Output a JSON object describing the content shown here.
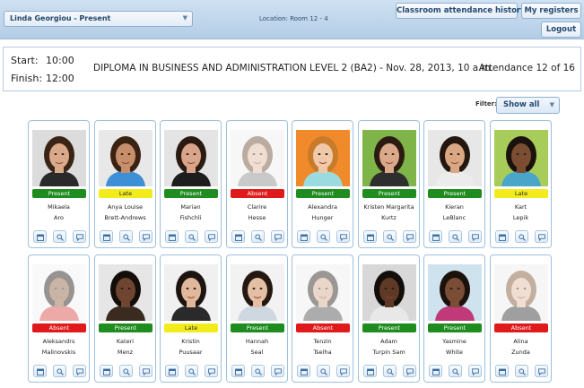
{
  "header": {
    "user_select": "Linda Georgiou - Present",
    "location": "Location: Room 12 - 4",
    "history_button": "Classroom attendance history",
    "registers_button": "My registers",
    "logout_button": "Logout"
  },
  "session": {
    "start_label": "Start:",
    "start_time": "10:00",
    "finish_label": "Finish:",
    "finish_time": "12:00",
    "course": "DIPLOMA IN BUSINESS AND ADMINISTRATION LEVEL 2 (BA2) - Nov. 28, 2013, 10 a.m.",
    "attendance": "Attendance 12 of 16"
  },
  "filter": {
    "label": "Filter:",
    "value": "Show all"
  },
  "colors": {
    "present": "#1f8c1f",
    "late": "#f2ec1d",
    "absent": "#e01a1a",
    "accent": "#244a73"
  },
  "students": [
    {
      "first": "Mikaela",
      "last": "Aro",
      "status": "Present",
      "skin": "#d9a98a",
      "hair": "#3a2416",
      "bg": "#dcdcdc",
      "shirt": "#2a2a2a"
    },
    {
      "first": "Anya Louise",
      "last": "Brett-Andrews",
      "status": "Late",
      "skin": "#c78e6b",
      "hair": "#3b2314",
      "bg": "#e8e8e8",
      "shirt": "#3d8fd6"
    },
    {
      "first": "Marian",
      "last": "Fishchli",
      "status": "Present",
      "skin": "#d8a58a",
      "hair": "#2b1a12",
      "bg": "#e4e4e4",
      "shirt": "#1d1d1d"
    },
    {
      "first": "Clarire",
      "last": "Hesse",
      "status": "Absent",
      "skin": "#e0b79c",
      "hair": "#6b4a32",
      "bg": "#efefef",
      "shirt": "#8a8a8a"
    },
    {
      "first": "Alexandra",
      "last": "Hunger",
      "status": "Present",
      "skin": "#f0c9a8",
      "hair": "#c97b2c",
      "bg": "#f08a2a",
      "shirt": "#9adbe0"
    },
    {
      "first": "Kristen Margarita",
      "last": "Kurtz",
      "status": "Present",
      "skin": "#d9a98a",
      "hair": "#2b1b12",
      "bg": "#7fb548",
      "shirt": "#2e2e2e"
    },
    {
      "first": "Kieran",
      "last": "LeBlanc",
      "status": "Present",
      "skin": "#d9a783",
      "hair": "#231710",
      "bg": "#e7e7e7",
      "shirt": "#ececec"
    },
    {
      "first": "Kart",
      "last": "Lepik",
      "status": "Late",
      "skin": "#7b4e33",
      "hair": "#1a120c",
      "bg": "#a8cc5a",
      "shirt": "#4aa6c8"
    },
    {
      "first": "Aleksandrs",
      "last": "Malinovskis",
      "status": "Absent",
      "skin": "#8a5a3c",
      "hair": "#1b120c",
      "bg": "#f2f2f2",
      "shirt": "#d94040"
    },
    {
      "first": "Kateri",
      "last": "Menz",
      "status": "Present",
      "skin": "#6e4530",
      "hair": "#140e0a",
      "bg": "#e6e6e6",
      "shirt": "#3a2a20"
    },
    {
      "first": "Kristin",
      "last": "Puusaar",
      "status": "Late",
      "skin": "#e2b89c",
      "hair": "#1c1410",
      "bg": "#f0f0f0",
      "shirt": "#2a2a2a"
    },
    {
      "first": "Hannah",
      "last": "Seal",
      "status": "Present",
      "skin": "#e4bfa4",
      "hair": "#241812",
      "bg": "#f2f2f2",
      "shirt": "#cfd8e0"
    },
    {
      "first": "Tenzin",
      "last": "Tselha",
      "status": "Absent",
      "skin": "#d2a78a",
      "hair": "#241a14",
      "bg": "#efefef",
      "shirt": "#4a4a4a"
    },
    {
      "first": "Adam",
      "last": "Turpin Sam",
      "status": "Present",
      "skin": "#5e3a26",
      "hair": "#140e0a",
      "bg": "#d8d8d8",
      "shirt": "#e8e8e8"
    },
    {
      "first": "Yasmine",
      "last": "White",
      "status": "Present",
      "skin": "#7a4e36",
      "hair": "#1c120c",
      "bg": "#cfe3ef",
      "shirt": "#c03a7a"
    },
    {
      "first": "Alina",
      "last": "Zunda",
      "status": "Absent",
      "skin": "#e2b89c",
      "hair": "#7a4f2e",
      "bg": "#ececec",
      "shirt": "#2d2d2d"
    }
  ]
}
